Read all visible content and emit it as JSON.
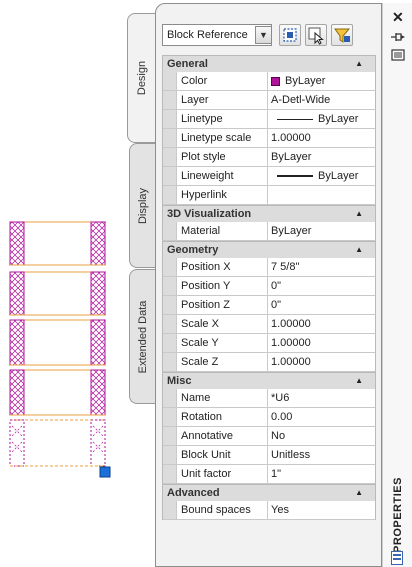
{
  "selector": {
    "value": "Block Reference"
  },
  "tabs": [
    {
      "label": "Design",
      "active": true
    },
    {
      "label": "Display",
      "active": false
    },
    {
      "label": "Extended Data",
      "active": false
    }
  ],
  "sections": [
    {
      "title": "General",
      "rows": [
        {
          "name": "Color",
          "value": "ByLayer",
          "kind": "color",
          "swatch": "#b0129a"
        },
        {
          "name": "Layer",
          "value": "A-Detl-Wide"
        },
        {
          "name": "Linetype",
          "value": "ByLayer",
          "kind": "linetype"
        },
        {
          "name": "Linetype scale",
          "value": "1.00000"
        },
        {
          "name": "Plot style",
          "value": "ByLayer"
        },
        {
          "name": "Lineweight",
          "value": "ByLayer",
          "kind": "lineweight"
        },
        {
          "name": "Hyperlink",
          "value": ""
        }
      ]
    },
    {
      "title": "3D Visualization",
      "rows": [
        {
          "name": "Material",
          "value": "ByLayer"
        }
      ]
    },
    {
      "title": "Geometry",
      "rows": [
        {
          "name": "Position X",
          "value": "7 5/8\""
        },
        {
          "name": "Position Y",
          "value": "0\""
        },
        {
          "name": "Position Z",
          "value": "0\""
        },
        {
          "name": "Scale X",
          "value": "1.00000"
        },
        {
          "name": "Scale Y",
          "value": "1.00000"
        },
        {
          "name": "Scale Z",
          "value": "1.00000"
        }
      ]
    },
    {
      "title": "Misc",
      "rows": [
        {
          "name": "Name",
          "value": "*U6"
        },
        {
          "name": "Rotation",
          "value": "0.00"
        },
        {
          "name": "Annotative",
          "value": "No"
        },
        {
          "name": "Block Unit",
          "value": "Unitless"
        },
        {
          "name": "Unit factor",
          "value": "1\""
        }
      ]
    },
    {
      "title": "Advanced",
      "rows": [
        {
          "name": "Bound spaces",
          "value": "Yes"
        }
      ]
    }
  ],
  "palette_title": "PROPERTIES",
  "colors": {
    "accent_magenta": "#b0129a",
    "grip_blue": "#1a6fd8",
    "bound_orange": "#e8a040"
  },
  "icons": [
    "chevron-down-icon",
    "quick-select-icon",
    "select-objects-icon",
    "toggle-pickadd-icon",
    "close-icon",
    "auto-hide-icon",
    "properties-menu-icon",
    "collapse-up-icon"
  ]
}
